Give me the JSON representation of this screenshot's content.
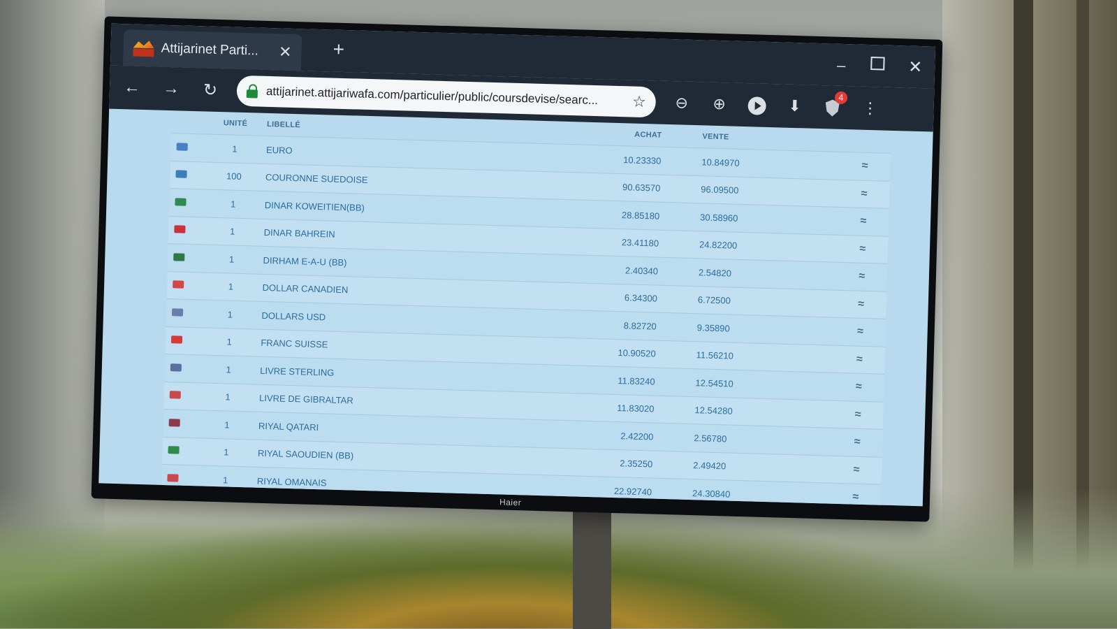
{
  "browser": {
    "tab_title": "Attijarinet Parti...",
    "tab_close": "✕",
    "new_tab": "+",
    "url": "attijarinet.attijariwafa.com/particulier/public/coursdevise/searc...",
    "badge_count": "4",
    "window": {
      "minimize": "–",
      "close": "✕"
    },
    "nav": {
      "back": "←",
      "forward": "→",
      "reload": "↻"
    },
    "icons": {
      "star": "☆",
      "zoom_out": "⊖",
      "zoom_in": "⊕",
      "download": "⬇",
      "menu": "⋮"
    }
  },
  "table": {
    "headers": {
      "unit": "UNITÉ",
      "label": "LIBELLÉ",
      "buy": "ACHAT",
      "sell": "VENTE"
    },
    "rows": [
      {
        "unit": "1",
        "label": "EURO",
        "buy": "10.23330",
        "sell": "10.84970",
        "flag": "#4a7fc1"
      },
      {
        "unit": "100",
        "label": "COURONNE SUEDOISE",
        "buy": "90.63570",
        "sell": "96.09500",
        "flag": "#3c7fb8"
      },
      {
        "unit": "1",
        "label": "DINAR KOWEITIEN(BB)",
        "buy": "28.85180",
        "sell": "30.58960",
        "flag": "#2f8a52"
      },
      {
        "unit": "1",
        "label": "DINAR BAHREIN",
        "buy": "23.41180",
        "sell": "24.82200",
        "flag": "#c8343a"
      },
      {
        "unit": "1",
        "label": "DIRHAM E-A-U (BB)",
        "buy": "2.40340",
        "sell": "2.54820",
        "flag": "#2c7a48"
      },
      {
        "unit": "1",
        "label": "DOLLAR CANADIEN",
        "buy": "6.34300",
        "sell": "6.72500",
        "flag": "#d64545"
      },
      {
        "unit": "1",
        "label": "DOLLARS USD",
        "buy": "8.82720",
        "sell": "9.35890",
        "flag": "#6a7fa8"
      },
      {
        "unit": "1",
        "label": "FRANC SUISSE",
        "buy": "10.90520",
        "sell": "11.56210",
        "flag": "#d83a3a"
      },
      {
        "unit": "1",
        "label": "LIVRE STERLING",
        "buy": "11.83240",
        "sell": "12.54510",
        "flag": "#5a6fa0"
      },
      {
        "unit": "1",
        "label": "LIVRE DE GIBRALTAR",
        "buy": "11.83020",
        "sell": "12.54280",
        "flag": "#c94a4a"
      },
      {
        "unit": "1",
        "label": "RIYAL QATARI",
        "buy": "2.42200",
        "sell": "2.56780",
        "flag": "#8a3a4a"
      },
      {
        "unit": "1",
        "label": "RIYAL SAOUDIEN (BB)",
        "buy": "2.35250",
        "sell": "2.49420",
        "flag": "#2f8a4a"
      },
      {
        "unit": "1",
        "label": "RIYAL OMANAIS",
        "buy": "22.92740",
        "sell": "24.30840",
        "flag": "#c84a4a"
      }
    ],
    "action_icon": "≈"
  },
  "monitor_brand": "Haier"
}
